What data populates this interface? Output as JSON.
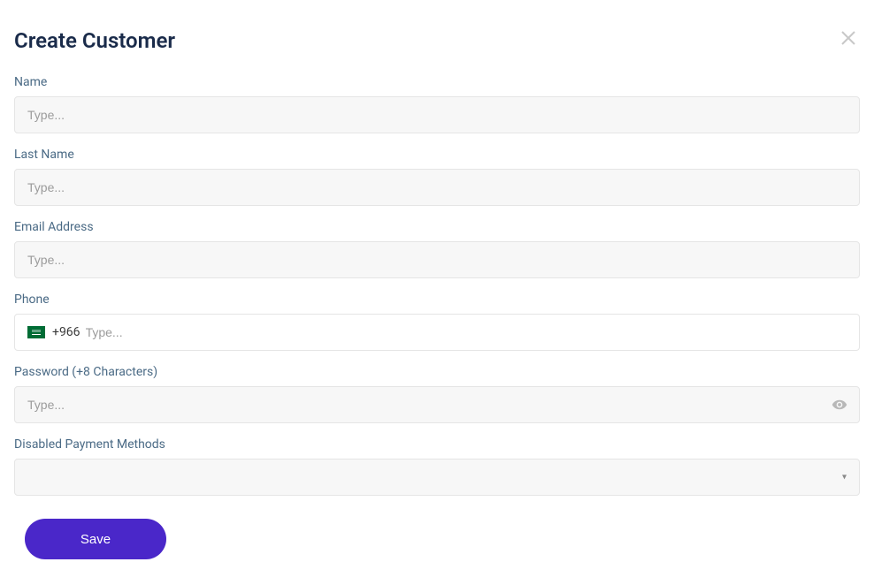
{
  "header": {
    "title": "Create Customer"
  },
  "fields": {
    "name": {
      "label": "Name",
      "placeholder": "Type..."
    },
    "last_name": {
      "label": "Last Name",
      "placeholder": "Type..."
    },
    "email": {
      "label": "Email Address",
      "placeholder": "Type..."
    },
    "phone": {
      "label": "Phone",
      "dial_code": "+966",
      "placeholder": "Type..."
    },
    "password": {
      "label": "Password (+8 Characters)",
      "placeholder": "Type..."
    },
    "disabled_payment": {
      "label": "Disabled Payment Methods"
    }
  },
  "actions": {
    "save_label": "Save"
  }
}
